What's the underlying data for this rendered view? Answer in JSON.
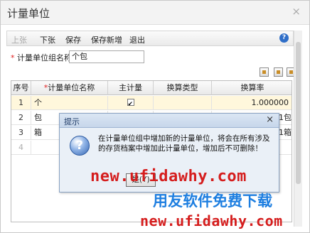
{
  "window": {
    "title": "计量单位"
  },
  "toolbar": {
    "items": [
      {
        "label": "上张",
        "disabled": true
      },
      {
        "label": "下张",
        "disabled": false
      },
      {
        "label": "保存",
        "disabled": false
      },
      {
        "label": "保存新增",
        "disabled": false
      },
      {
        "label": "退出",
        "disabled": false
      }
    ],
    "help_icon": "?"
  },
  "form": {
    "required_mark": "*",
    "group_name_label": "计量单位组名称",
    "group_name_value": "个包"
  },
  "grid": {
    "columns": [
      "序号",
      "计量单位名称",
      "主计量",
      "换算类型",
      "换算率"
    ],
    "required_mark": "*",
    "rows": [
      {
        "no": "1",
        "name": "个",
        "main": true,
        "type": "",
        "rate": "1.000000"
      },
      {
        "no": "2",
        "name": "包",
        "main": false,
        "type": "",
        "rate": ""
      },
      {
        "no": "3",
        "name": "箱",
        "main": false,
        "type": "",
        "rate": ""
      },
      {
        "no": "4",
        "name": "",
        "main": false,
        "type": "",
        "rate": ""
      }
    ],
    "overflow_cells": [
      "1包",
      "1箱"
    ]
  },
  "dialog": {
    "title": "提示",
    "icon": "?",
    "message": "在计量单位组中增加新的计量单位，将会在所有涉及的存货档案中增加此计量单位，增加后不可删除！",
    "ok_label": "是(Y)"
  },
  "watermark": {
    "line1": "new.ufidawhy.com",
    "line2": "用友软件免费下载",
    "line3": "new.ufidawhy.com"
  }
}
